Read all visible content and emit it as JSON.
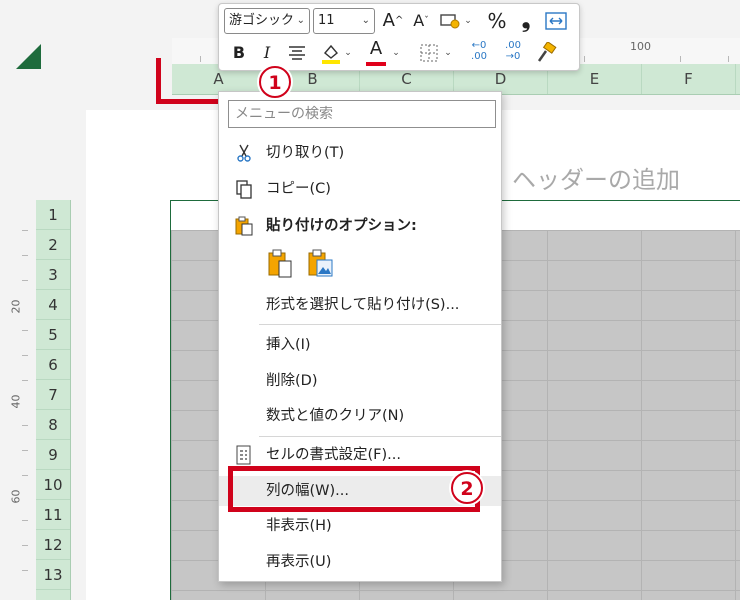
{
  "toolbar": {
    "font_name": "游ゴシック",
    "font_size": "11",
    "increase_font": "A^",
    "decrease_font": "Aˇ",
    "percent": "%",
    "comma": "❟",
    "bold": "B",
    "italic": "I",
    "font_color_letter": "A",
    "decimal_inc": "←0\n.00",
    "decimal_dec": ".00\n→0"
  },
  "ruler": {
    "h_label": "100",
    "v_labels": [
      "20",
      "40",
      "60"
    ]
  },
  "columns": [
    "A",
    "B",
    "C",
    "D",
    "E",
    "F"
  ],
  "rows": [
    "1",
    "2",
    "3",
    "4",
    "5",
    "6",
    "7",
    "8",
    "9",
    "10",
    "11",
    "12",
    "13"
  ],
  "page": {
    "header_hint": "ヘッダーの追加"
  },
  "context_menu": {
    "search_placeholder": "メニューの検索",
    "cut": "切り取り(T)",
    "copy": "コピー(C)",
    "paste_options": "貼り付けのオプション:",
    "paste_special": "形式を選択して貼り付け(S)...",
    "insert": "挿入(I)",
    "delete": "削除(D)",
    "clear": "数式と値のクリア(N)",
    "format_cells": "セルの書式設定(F)...",
    "column_width": "列の幅(W)...",
    "hide": "非表示(H)",
    "unhide": "再表示(U)"
  },
  "annotations": {
    "step1": "1",
    "step2": "2"
  },
  "colors": {
    "accent_red": "#d0021b",
    "header_green": "#cfe8d4",
    "excel_green": "#1e6b3c"
  }
}
